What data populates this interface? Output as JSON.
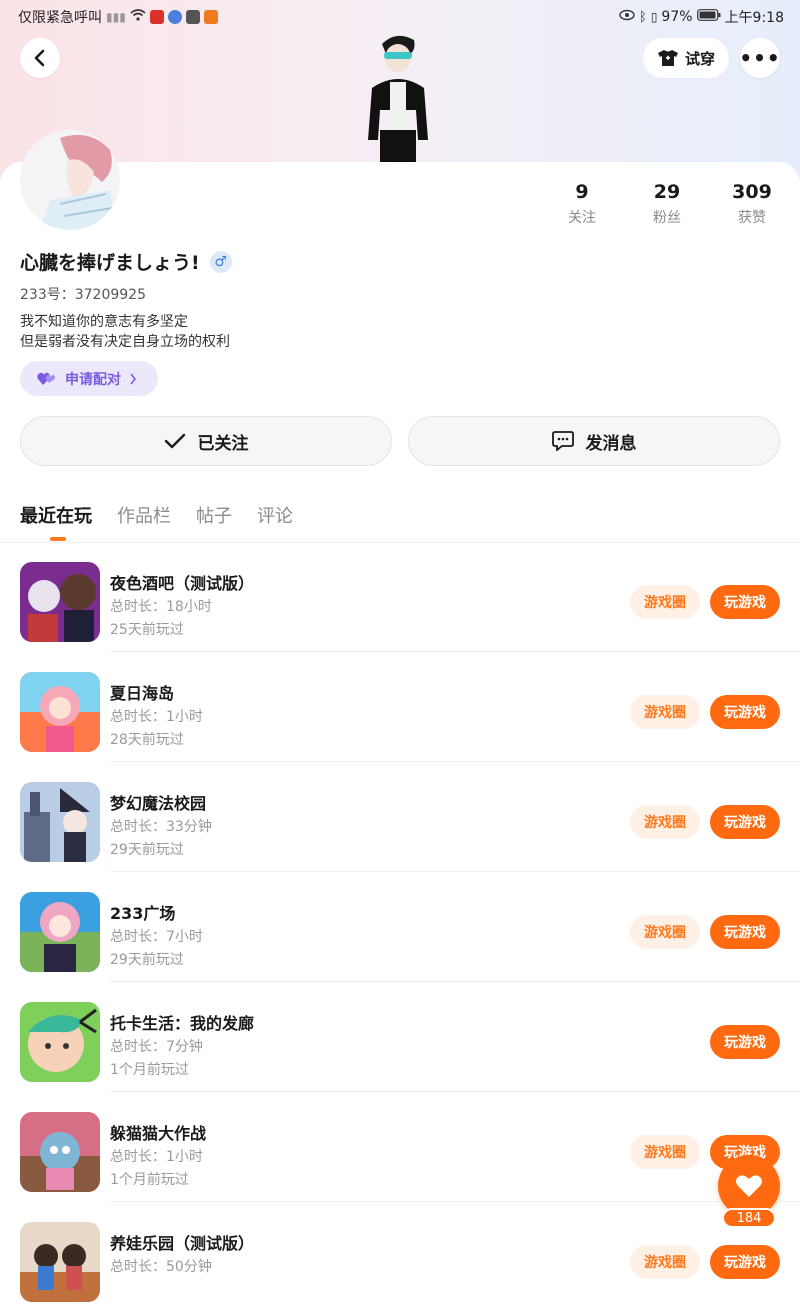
{
  "status_bar": {
    "carrier_text": "仅限紧急呼叫",
    "battery": "97%",
    "time": "上午9:18"
  },
  "header": {
    "tryon_label": "试穿"
  },
  "profile": {
    "stats": [
      {
        "num": "9",
        "label": "关注"
      },
      {
        "num": "29",
        "label": "粉丝"
      },
      {
        "num": "309",
        "label": "获赞"
      }
    ],
    "username": "心臓を捧げましょう!",
    "gender_symbol": "♂",
    "id_line": "233号：37209925",
    "bio_line1": "我不知道你的意志有多坚定",
    "bio_line2": "但是弱者没有决定自身立场的权利",
    "pair_label": "申请配对",
    "follow_label": "已关注",
    "message_label": "发消息"
  },
  "tabs": [
    "最近在玩",
    "作品栏",
    "帖子",
    "评论"
  ],
  "games": [
    {
      "title": "夜色酒吧（测试版）",
      "duration": "总时长：18小时",
      "ago": "25天前玩过",
      "circle": "游戏圈",
      "play": "玩游戏"
    },
    {
      "title": "夏日海岛",
      "duration": "总时长：1小时",
      "ago": "28天前玩过",
      "circle": "游戏圈",
      "play": "玩游戏"
    },
    {
      "title": "梦幻魔法校园",
      "duration": "总时长：33分钟",
      "ago": "29天前玩过",
      "circle": "游戏圈",
      "play": "玩游戏"
    },
    {
      "title": "233广场",
      "duration": "总时长：7小时",
      "ago": "29天前玩过",
      "circle": "游戏圈",
      "play": "玩游戏"
    },
    {
      "title": "托卡生活：我的发廊",
      "duration": "总时长：7分钟",
      "ago": "1个月前玩过",
      "circle": "",
      "play": "玩游戏"
    },
    {
      "title": "躲猫猫大作战",
      "duration": "总时长：1小时",
      "ago": "1个月前玩过",
      "circle": "游戏圈",
      "play": "玩游戏"
    },
    {
      "title": "养娃乐园（测试版）",
      "duration": "总时长：50分钟",
      "ago": "",
      "circle": "游戏圈",
      "play": "玩游戏"
    }
  ],
  "fab": {
    "count": "184"
  },
  "colors": {
    "accent": "#ff6a10",
    "accent_soft": "#fff0e6",
    "purple": "#7a5ce0"
  }
}
